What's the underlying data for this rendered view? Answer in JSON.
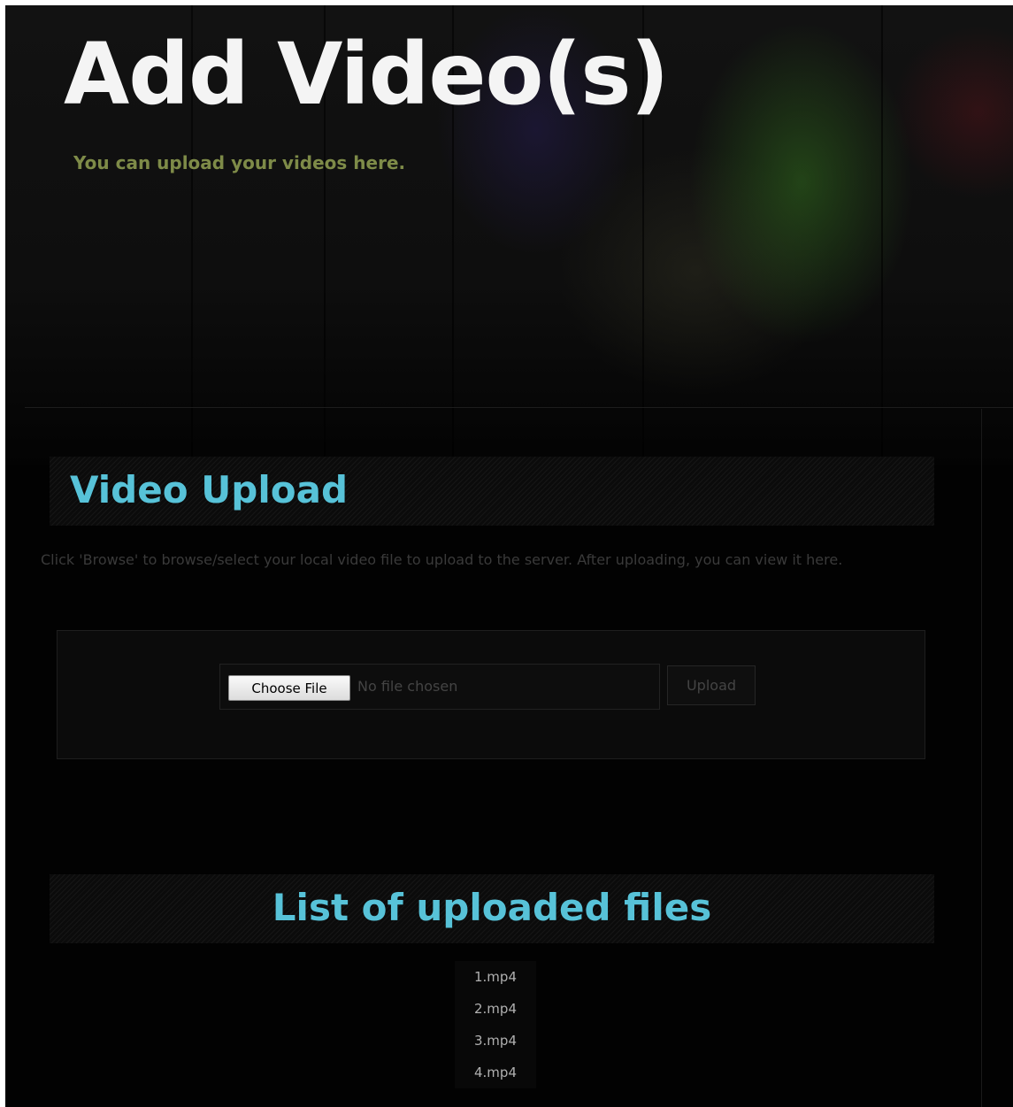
{
  "hero": {
    "title": "Add Video(s)",
    "subtitle": "You can upload your videos here."
  },
  "upload_section": {
    "title": "Video Upload",
    "instructions": "Click 'Browse' to browse/select your local video file to upload to the server. After uploading, you can view it here.",
    "choose_file_label": "Choose File",
    "file_status": "No file chosen",
    "upload_label": "Upload"
  },
  "list_section": {
    "title": "List of uploaded files",
    "files": [
      "1.mp4",
      "2.mp4",
      "3.mp4",
      "4.mp4"
    ]
  },
  "colors": {
    "heading_accent": "#57c2d8",
    "subtitle": "#7e8b48",
    "background": "#020202"
  }
}
